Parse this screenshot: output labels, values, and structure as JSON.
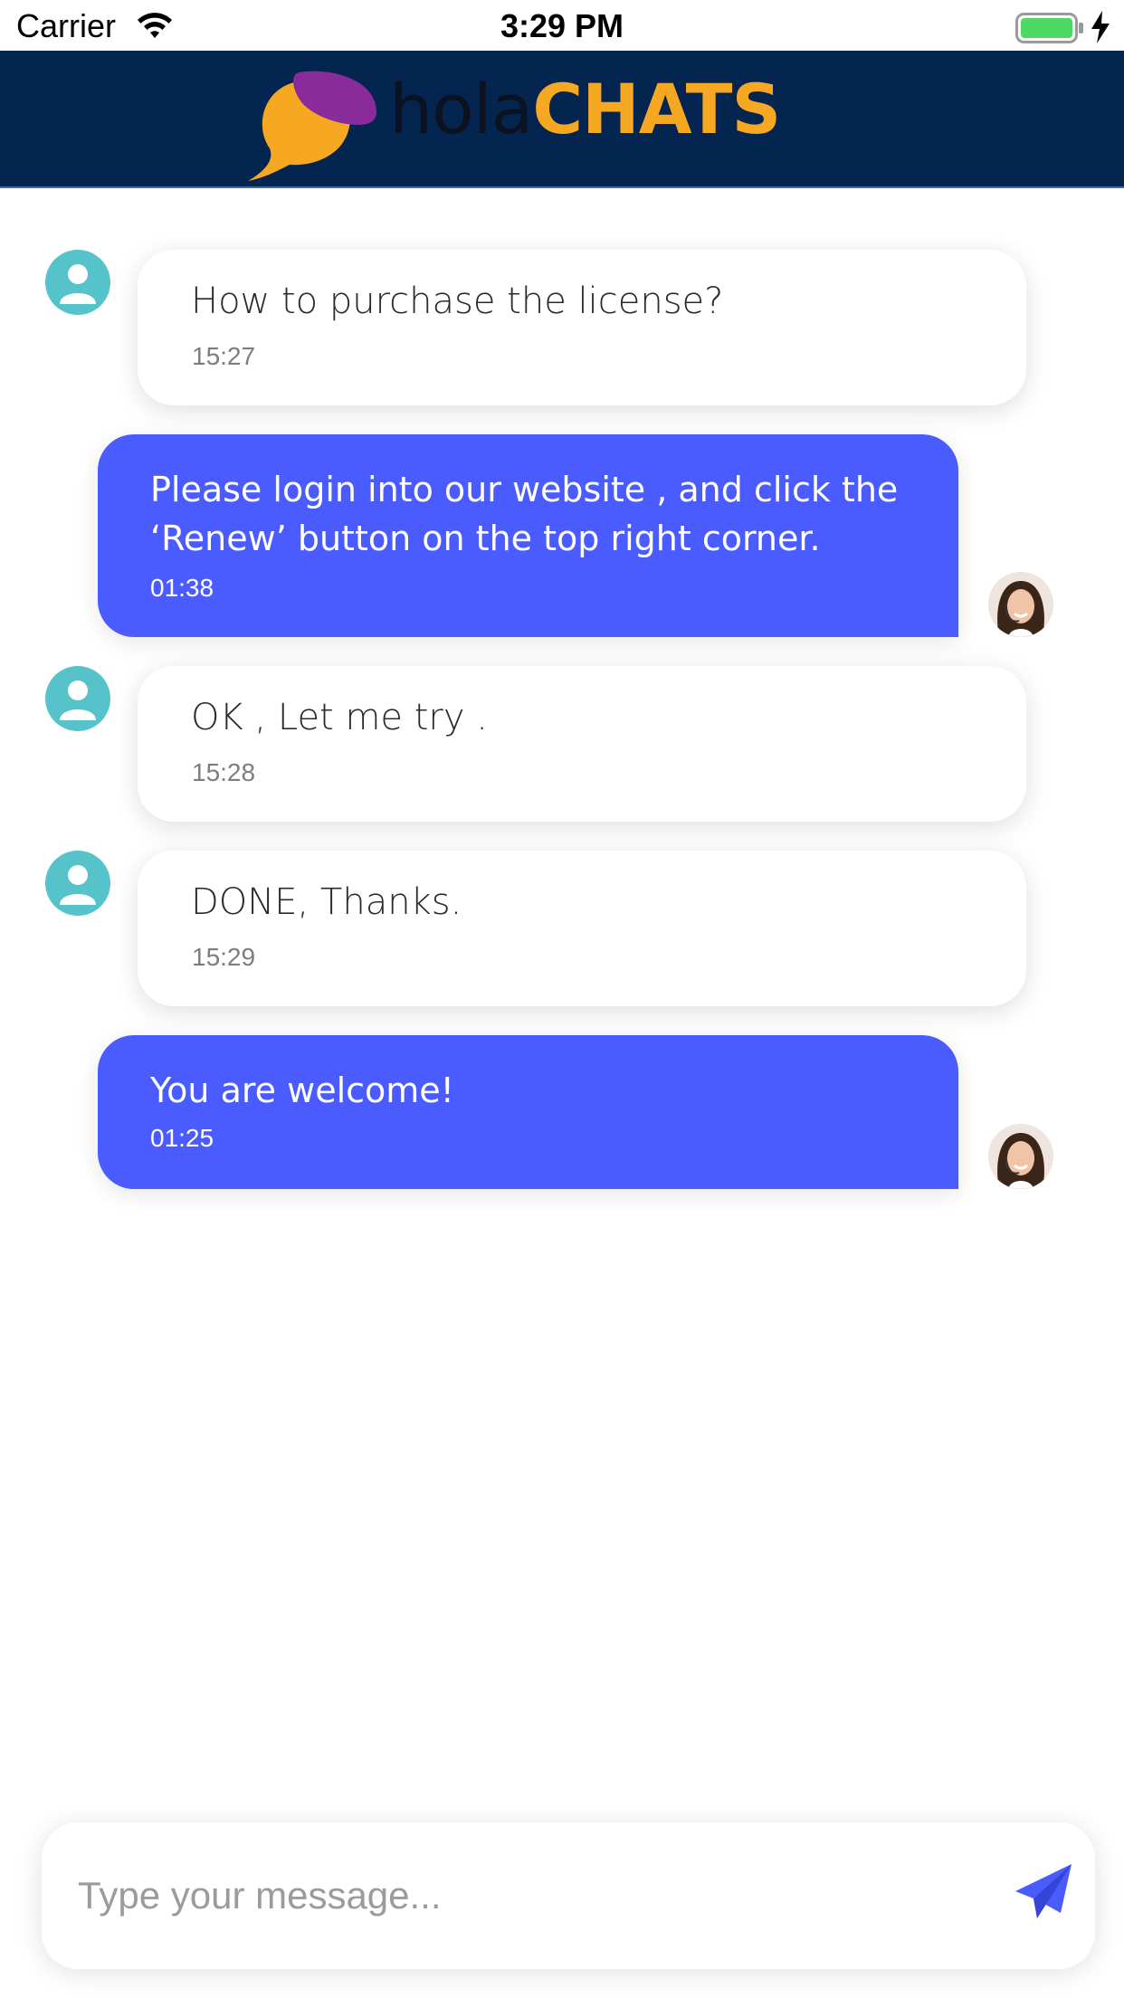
{
  "status_bar": {
    "carrier": "Carrier",
    "time": "3:29 PM",
    "icons": [
      "wifi-icon",
      "battery-icon",
      "charging-bolt-icon"
    ]
  },
  "header": {
    "logo_hola": "hola",
    "logo_chats": "CHATS",
    "colors": {
      "background": "#032550",
      "logo_orange": "#f7a823",
      "logo_purple": "#8a2b9b"
    }
  },
  "messages": [
    {
      "direction": "incoming",
      "text": "How to purchase the license?",
      "time": "15:27"
    },
    {
      "direction": "outgoing",
      "text_line1": "Please login into our website , and click the",
      "text_line2": "‘Renew’ button on the top right corner.",
      "time": "01:38"
    },
    {
      "direction": "incoming",
      "text": "OK , Let me try .",
      "time": "15:28"
    },
    {
      "direction": "incoming",
      "text": "DONE, Thanks.",
      "time": "15:29"
    },
    {
      "direction": "outgoing",
      "text": "You are welcome!",
      "time": "01:25"
    }
  ],
  "composer": {
    "placeholder": "Type your message...",
    "value": "",
    "send_icon": "paper-plane-icon"
  },
  "theme": {
    "outgoing_bubble": "#4a5cff",
    "incoming_bubble": "#ffffff",
    "user_avatar": "#56c3cb"
  }
}
